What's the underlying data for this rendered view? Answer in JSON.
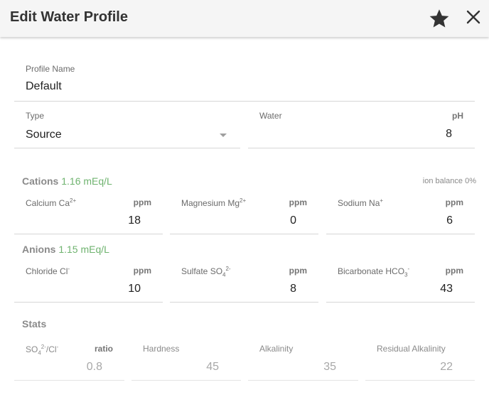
{
  "header": {
    "title": "Edit Water Profile",
    "star_icon": "star-icon",
    "close_icon": "close-icon"
  },
  "profile_name": {
    "label": "Profile Name",
    "value": "Default"
  },
  "type": {
    "label": "Type",
    "value": "Source"
  },
  "water": {
    "label": "Water",
    "unit": "pH",
    "value": "8"
  },
  "cations": {
    "title": "Cations",
    "meq": "1.16 mEq/L",
    "ion_balance": "ion balance 0%",
    "calcium": {
      "label": "Calcium Ca",
      "sup": "2+",
      "unit": "ppm",
      "value": "18"
    },
    "magnesium": {
      "label": "Magnesium Mg",
      "sup": "2+",
      "unit": "ppm",
      "value": "0"
    },
    "sodium": {
      "label": "Sodium Na",
      "sup": "+",
      "unit": "ppm",
      "value": "6"
    }
  },
  "anions": {
    "title": "Anions",
    "meq": "1.15 mEq/L",
    "chloride": {
      "label": "Chloride Cl",
      "sup": "-",
      "unit": "ppm",
      "value": "10"
    },
    "sulfate": {
      "label": "Sulfate SO",
      "sub": "4",
      "sup": "2-",
      "unit": "ppm",
      "value": "8"
    },
    "bicarbonate": {
      "label": "Bicarbonate HCO",
      "sub": "3",
      "sup": "-",
      "unit": "ppm",
      "value": "43"
    }
  },
  "stats": {
    "title": "Stats",
    "ratio": {
      "label_a": "SO",
      "sub": "4",
      "sup": "2-",
      "label_b": "/Cl",
      "sup2": "-",
      "unit": "ratio",
      "value": "0.8"
    },
    "hardness": {
      "label": "Hardness",
      "value": "45"
    },
    "alkalinity": {
      "label": "Alkalinity",
      "value": "35"
    },
    "residual_alkalinity": {
      "label": "Residual Alkalinity",
      "value": "22"
    }
  }
}
